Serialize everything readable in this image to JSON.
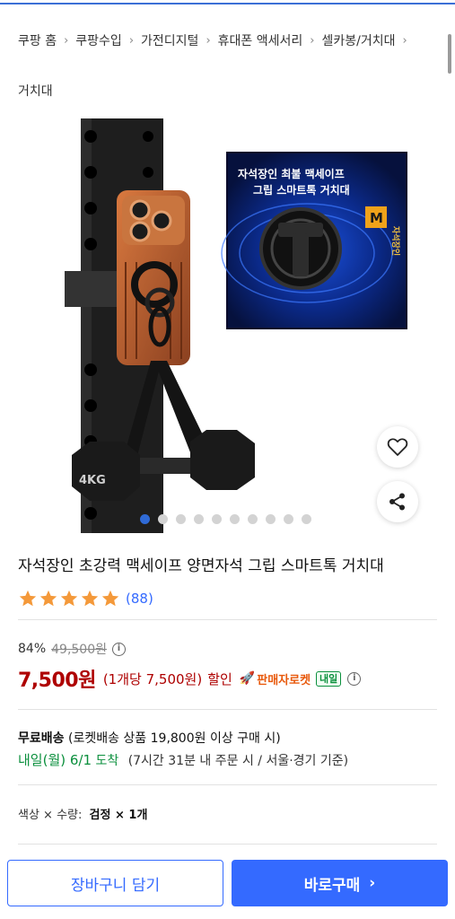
{
  "breadcrumb": {
    "items": [
      "쿠팡 홈",
      "쿠팡수입",
      "가전디지털",
      "휴대폰 액세서리",
      "셀카봉/거치대"
    ],
    "last": "거치대"
  },
  "gallery": {
    "box_title_line1": "자석장인 최불 맥세이프",
    "box_title_line2": "그립 스마트톡 거치대",
    "box_side_text": "자석장인",
    "box_badge": "M",
    "dumbbell_label": "4KG",
    "dot_count": 10,
    "active_dot": 0
  },
  "product": {
    "title": "자석장인 초강력 맥세이프 양면자석 그립 스마트톡 거치대",
    "rating_stars": 5,
    "review_count": "(88)"
  },
  "pricing": {
    "discount_rate": "84%",
    "original_price": "49,500원",
    "price": "7,500원",
    "unit_price": "(1개당 7,500원)",
    "sale_label": "할인",
    "rocket_label": "판매자로켓",
    "tomorrow_badge": "내일"
  },
  "shipping": {
    "free_label": "무료배송",
    "free_condition": "(로켓배송 상품 19,800원 이상 구매 시)",
    "arrive_date": "내일(월) 6/1",
    "arrive_suffix": "도착",
    "arrive_condition": "(7시간 31분 내 주문 시 / 서울·경기 기준)"
  },
  "option": {
    "label": "색상 × 수량:",
    "value": "검정 × 1개"
  },
  "actions": {
    "cart_label": "장바구니 담기",
    "buy_label": "바로구매",
    "buy_chevron": "›"
  },
  "colors": {
    "accent": "#346aff",
    "price_red": "#ae0000",
    "rocket_green": "#0a8f3c",
    "star": "#f4993a"
  }
}
